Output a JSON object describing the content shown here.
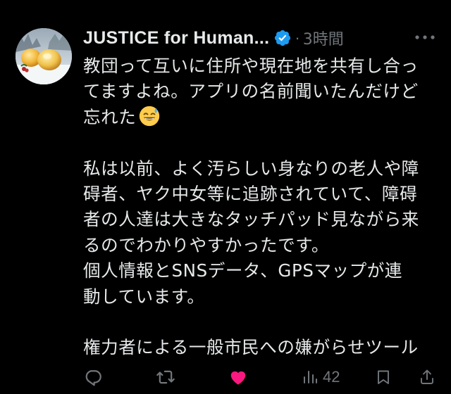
{
  "tweet": {
    "author_name": "JUSTICE for Human...",
    "separator": "·",
    "timestamp": "3時間",
    "body_lines": [
      "教団って互いに住所や現在地を共有し合っ",
      "てますよね。アプリの名前聞いたんだけど",
      "忘れた",
      "",
      "私は以前、よく汚らしい身なりの老人や障",
      "碍者、ヤク中女等に追跡されていて、障碍",
      "者の人達は大きなタッチパッド見ながら来",
      "るのでわかりやすかったです。",
      "個人情報とSNSデータ、GPSマップが連",
      "動しています。",
      "",
      "権力者による一般市民への嫌がらせツール"
    ],
    "emoji": "sweat-smile-emoji"
  },
  "actions": {
    "reply_icon": "reply-icon",
    "retweet_icon": "retweet-icon",
    "like_icon": "heart-icon",
    "like_color": "#f91880",
    "views_icon": "views-icon",
    "views_count": "42",
    "bookmark_icon": "bookmark-icon",
    "share_icon": "share-icon"
  },
  "colors": {
    "background": "#000000",
    "text": "#e7e9ea",
    "muted": "#71767b",
    "verified": "#1d9bf0"
  }
}
